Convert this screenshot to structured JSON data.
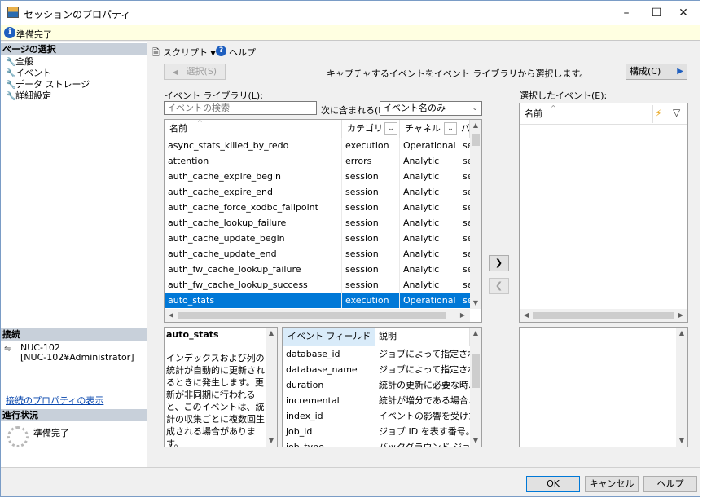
{
  "window": {
    "title": "セッションのプロパティ",
    "minimize": "–",
    "maximize": "☐",
    "close": "✕",
    "status": "準備完了"
  },
  "left": {
    "page_select_header": "ページの選択",
    "nav": [
      "全般",
      "イベント",
      "データ ストレージ",
      "詳細設定"
    ],
    "connection_header": "接続",
    "server": "NUC-102",
    "user": "[NUC-102¥Administrator]",
    "connection_link": "接続のプロパティの表示",
    "progress_header": "進行状況",
    "progress_status": "準備完了"
  },
  "toolbar": {
    "script": "スクリプト",
    "help": "ヘルプ"
  },
  "top": {
    "select_button": "選択(S)",
    "description": "キャプチャするイベントをイベント ライブラリから選択します。",
    "configure_button": "構成(C)"
  },
  "library": {
    "label": "イベント ライブラリ(L):",
    "search_placeholder": "イベントの検索",
    "contains_label": "次に含まれる(I)",
    "filter_value": "イベント名のみ",
    "columns": [
      "名前",
      "カテゴリ",
      "チャネル",
      "パ"
    ],
    "rows": [
      [
        "async_stats_killed_by_redo",
        "execution",
        "Operational",
        "se"
      ],
      [
        "attention",
        "errors",
        "Analytic",
        "se"
      ],
      [
        "auth_cache_expire_begin",
        "session",
        "Analytic",
        "se"
      ],
      [
        "auth_cache_expire_end",
        "session",
        "Analytic",
        "se"
      ],
      [
        "auth_cache_force_xodbc_failpoint",
        "session",
        "Analytic",
        "se"
      ],
      [
        "auth_cache_lookup_failure",
        "session",
        "Analytic",
        "se"
      ],
      [
        "auth_cache_update_begin",
        "session",
        "Analytic",
        "se"
      ],
      [
        "auth_cache_update_end",
        "session",
        "Analytic",
        "se"
      ],
      [
        "auth_fw_cache_lookup_failure",
        "session",
        "Analytic",
        "se"
      ],
      [
        "auth_fw_cache_lookup_success",
        "session",
        "Analytic",
        "se"
      ],
      [
        "auto_stats",
        "execution",
        "Operational",
        "se"
      ]
    ],
    "selected_row": 10
  },
  "details": {
    "event_name": "auto_stats",
    "event_description": "インデックスおよび列の統計が自動的に更新されるときに発生します。更新が非同期に行われると、このイベントは、統計の収集ごとに複数回生成される場合があります。",
    "fields_header": [
      "イベント フィールド",
      "説明"
    ],
    "fields": [
      [
        "database_id",
        "ジョブによって指定される..."
      ],
      [
        "database_name",
        "ジョブによって指定された..."
      ],
      [
        "duration",
        "統計の更新に必要な時..."
      ],
      [
        "incremental",
        "統計が増分である場合..."
      ],
      [
        "index_id",
        "イベントの影響を受けた..."
      ],
      [
        "job_id",
        "ジョブ ID を表す番号。"
      ],
      [
        "job_type",
        "バックグラウンド ジョブの..."
      ]
    ]
  },
  "move": {
    "add": "❯",
    "remove": "❮"
  },
  "selected": {
    "label": "選択したイベント(E):",
    "column": "名前"
  },
  "footer": {
    "ok": "OK",
    "cancel": "キャンセル",
    "help": "ヘルプ"
  }
}
